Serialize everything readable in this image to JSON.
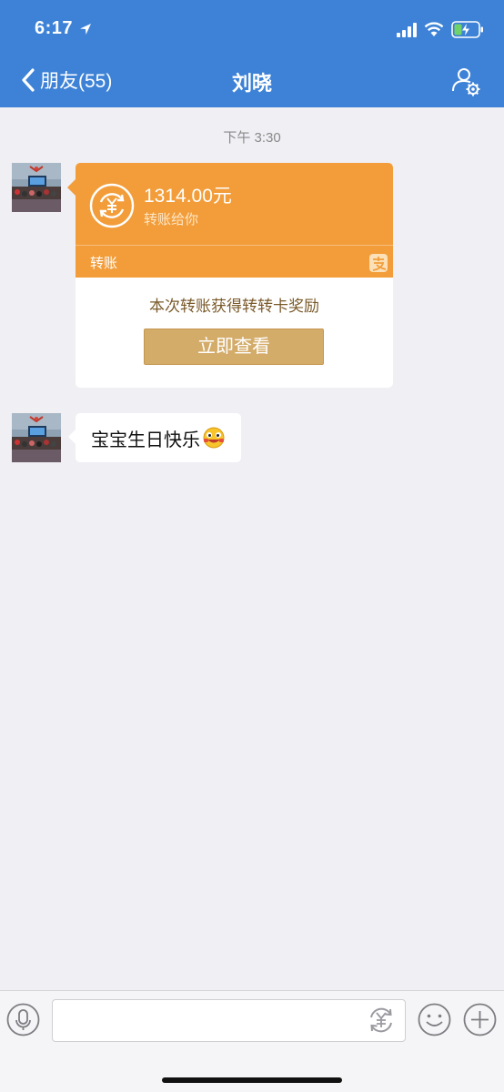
{
  "status_bar": {
    "time": "6:17"
  },
  "nav": {
    "back_label": "朋友(55)",
    "title": "刘晓"
  },
  "chat": {
    "timestamp": "下午 3:30",
    "transfer": {
      "amount": "1314.00元",
      "subtitle": "转账给你",
      "type_label": "转账",
      "reward_text": "本次转账获得转转卡奖励",
      "button_label": "立即查看"
    },
    "message": {
      "text": "宝宝生日快乐"
    }
  },
  "colors": {
    "header": "#3d82d6",
    "transfer_orange": "#f29d3a",
    "button_gold": "#d4ac6a",
    "background": "#efeff4"
  },
  "icons": [
    "location-arrow-icon",
    "signal-icon",
    "wifi-icon",
    "battery-charging-icon",
    "chevron-left-icon",
    "profile-settings-icon",
    "transfer-icon",
    "alipay-icon",
    "emoji-icon",
    "voice-icon",
    "yuan-icon",
    "smiley-icon",
    "plus-icon"
  ]
}
